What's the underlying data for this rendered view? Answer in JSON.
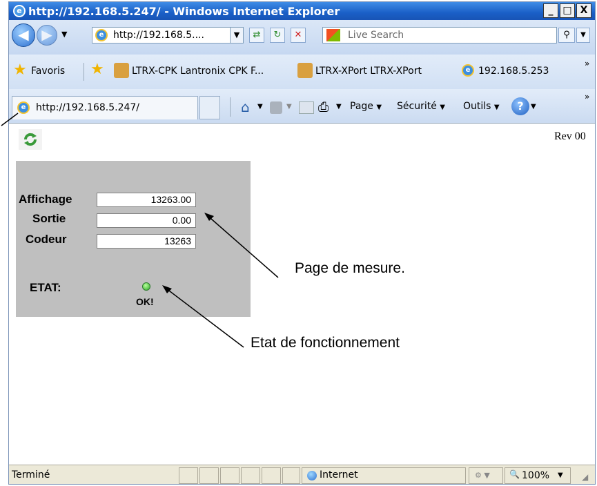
{
  "window": {
    "title": "http://192.168.5.247/ - Windows Internet Explorer",
    "buttons": {
      "minimize": "_",
      "maximize": "□",
      "close": "X"
    }
  },
  "toolbar": {
    "address": "http://192.168.5....",
    "search_placeholder": "Live Search"
  },
  "favorites_bar": {
    "favorites_label": "Favoris",
    "links": [
      "LTRX-CPK Lantronix CPK F...",
      "LTRX-XPort LTRX-XPort",
      "192.168.5.253"
    ]
  },
  "tab_bar": {
    "tab_title": "http://192.168.5.247/",
    "commands": {
      "page": "Page",
      "security": "Sécurité",
      "tools": "Outils"
    }
  },
  "page": {
    "revision": "Rev 00",
    "fields": [
      {
        "label": "Affichage",
        "value": "13263.00"
      },
      {
        "label": "Sortie",
        "value": "0.00"
      },
      {
        "label": "Codeur",
        "value": "13263"
      }
    ],
    "state_label": "ETAT:",
    "state_text": "OK!",
    "state_color": "#2ea82a"
  },
  "annotations": {
    "measure_page": "Page de mesure.",
    "operating_state": "Etat de fonctionnement"
  },
  "status_bar": {
    "status": "Terminé",
    "zone": "Internet",
    "zoom": "100%"
  }
}
